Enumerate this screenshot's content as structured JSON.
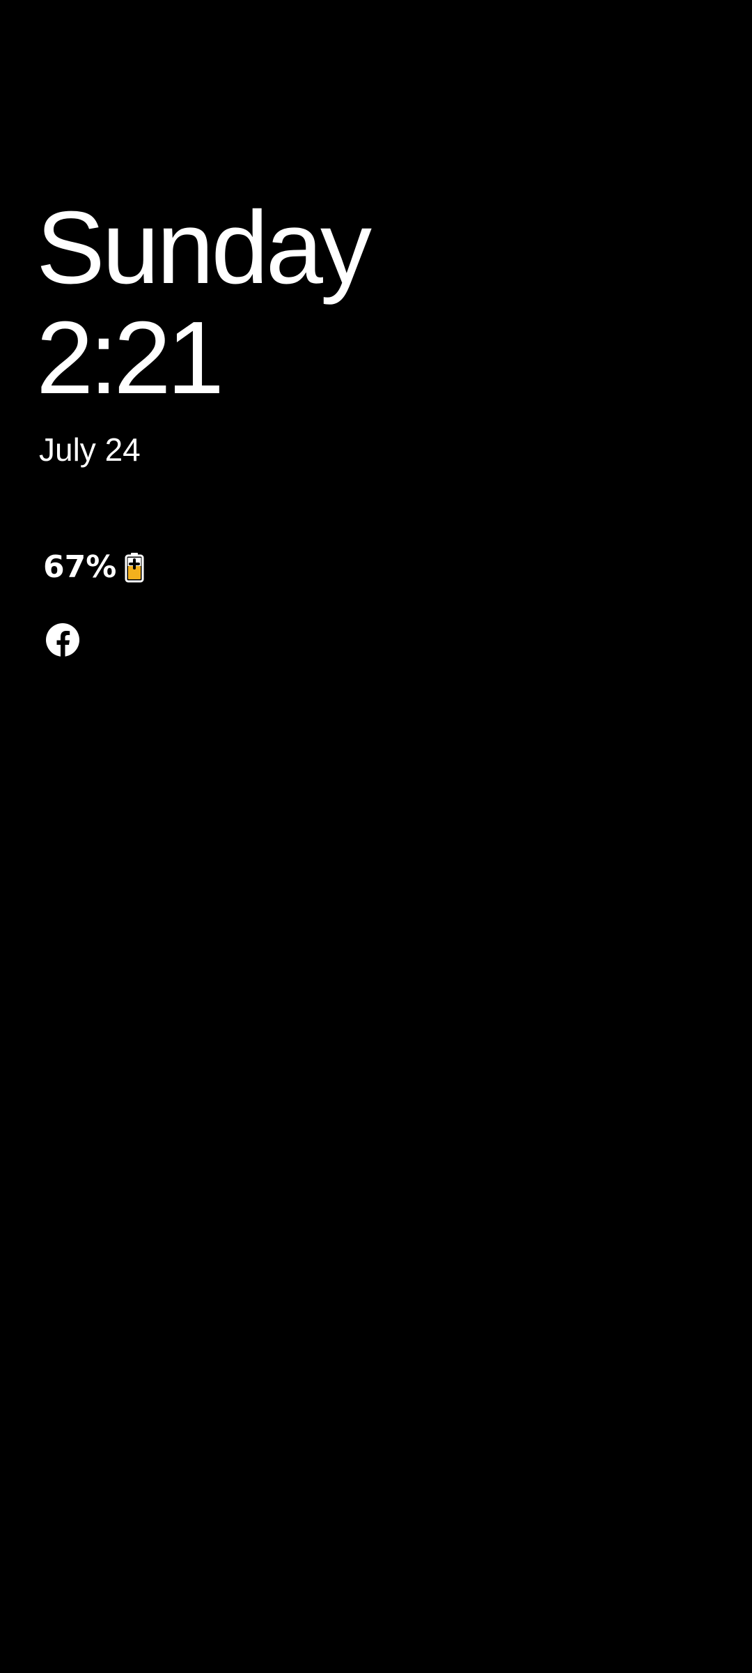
{
  "lockscreen": {
    "day": "Sunday",
    "time": "2:21",
    "date": "July 24",
    "battery": {
      "percent_text": "67%",
      "level": 0.67,
      "charging": true,
      "icon": "battery-charging-icon",
      "fill_color": "#f2b01e"
    },
    "notification_icons": [
      {
        "icon": "facebook-icon",
        "app": "Facebook"
      }
    ]
  },
  "colors": {
    "background": "#000000",
    "text": "#ffffff",
    "battery_fill": "#f2b01e"
  }
}
